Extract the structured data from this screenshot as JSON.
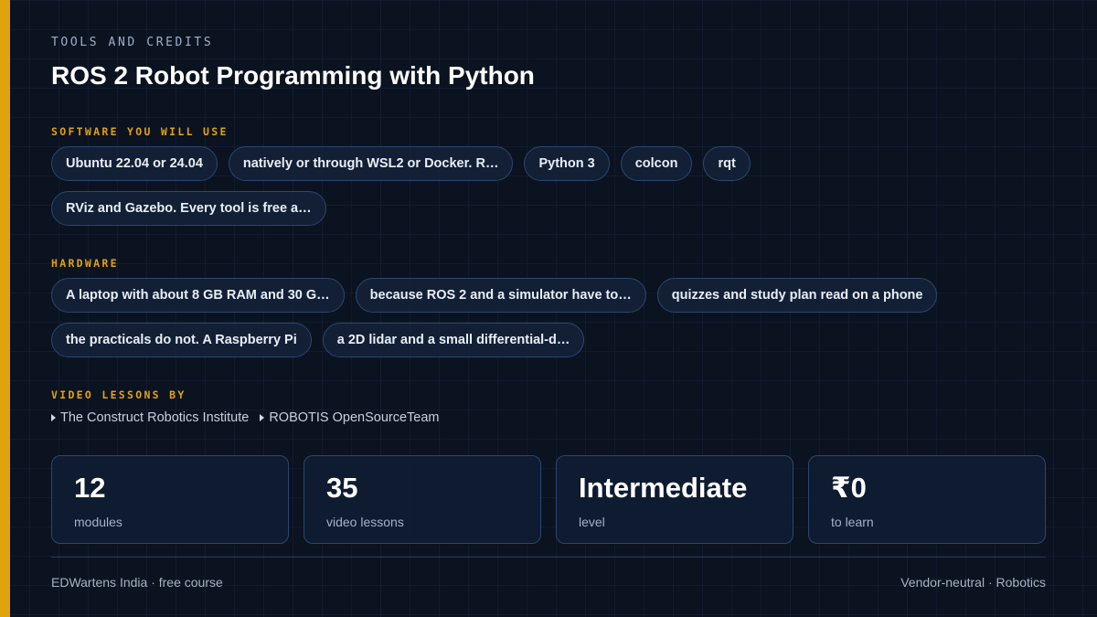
{
  "header": {
    "eyebrow": "TOOLS AND CREDITS",
    "title": "ROS 2 Robot Programming with Python"
  },
  "software": {
    "label": "SOFTWARE YOU WILL USE",
    "chips": [
      "Ubuntu 22.04 or 24.04",
      "natively or through WSL2 or Docker. R…",
      "Python 3",
      "colcon",
      "rqt",
      "RViz and Gazebo. Every tool is free a…"
    ]
  },
  "hardware": {
    "label": "HARDWARE",
    "chips": [
      "A laptop with about 8 GB RAM and 30 G…",
      "because ROS 2 and a simulator have to…",
      "quizzes and study plan read on a phone",
      "the practicals do not. A Raspberry Pi",
      "a 2D lidar and a small differential-d…"
    ]
  },
  "video_lessons": {
    "label": "VIDEO LESSONS BY",
    "creators": [
      "The Construct Robotics Institute",
      "ROBOTIS OpenSourceTeam"
    ]
  },
  "stats": [
    {
      "value": "12",
      "label": "modules"
    },
    {
      "value": "35",
      "label": "video lessons"
    },
    {
      "value": "Intermediate",
      "label": "level"
    },
    {
      "value": "₹0",
      "label": "to learn"
    }
  ],
  "footer": {
    "left": "EDWartens India · free course",
    "right": "Vendor-neutral · Robotics"
  },
  "colors": {
    "accent": "#e2a20f",
    "background": "#0b1220",
    "chip_border": "#2c4770"
  }
}
